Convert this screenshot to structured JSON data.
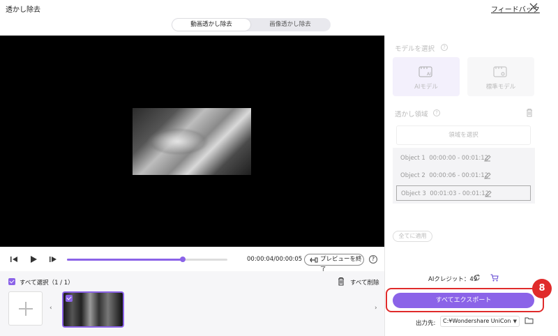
{
  "app": {
    "title": "透かし除去",
    "feedback": "フィードバック"
  },
  "tabs": [
    {
      "label": "動画透かし除去",
      "active": true
    },
    {
      "label": "画像透かし除去",
      "active": false
    }
  ],
  "player": {
    "time": "00:00:04/00:00:05",
    "progress_fraction": 0.72,
    "preview_button": "プレビューを終了",
    "help": "?"
  },
  "clips": {
    "select_all": "すべて選択（1 / 1）",
    "delete_all": "すべて削除",
    "prev": "‹",
    "next": "›"
  },
  "panel": {
    "model_heading": "モデルを選択",
    "models": [
      {
        "label": "AIモデル",
        "icon": "ai-model-icon"
      },
      {
        "label": "標準モデル",
        "icon": "standard-model-icon"
      }
    ],
    "area_heading": "透かし領域",
    "select_area": "領域を選択",
    "objects": [
      {
        "name": "Object 1",
        "range": "00:00:00 - 00:01:12"
      },
      {
        "name": "Object 2",
        "range": "00:00:06 - 00:01:12"
      },
      {
        "name": "Object 3",
        "range": "00:01:03 - 00:01:12"
      }
    ],
    "apply_all": "全てに適用"
  },
  "footer": {
    "credit": "AIクレジット：49",
    "export": "すべてエクスポート",
    "step_badge": "8",
    "output_label": "出力先:",
    "output_path": "C:¥Wondershare UniCon"
  },
  "colors": {
    "accent": "#8b63e8",
    "highlight": "#e02b2b"
  }
}
